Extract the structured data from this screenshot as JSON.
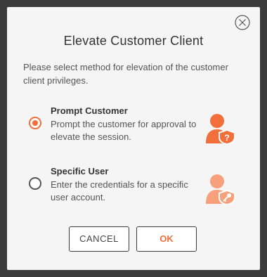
{
  "dialog": {
    "title": "Elevate Customer Client",
    "description": "Please select method for elevation of the customer client privileges.",
    "close_icon": "close-icon"
  },
  "options": [
    {
      "title": "Prompt Customer",
      "description": "Prompt the customer for approval to elevate the session.",
      "selected": true,
      "icon": "user-shield-question-icon"
    },
    {
      "title": "Specific User",
      "description": "Enter the credentials for a specific user account.",
      "selected": false,
      "icon": "user-shield-key-icon"
    }
  ],
  "buttons": {
    "cancel_label": "CANCEL",
    "ok_label": "OK"
  },
  "colors": {
    "accent": "#f26e3a",
    "accent_light": "#f7a07c",
    "background": "#f5f5f5",
    "backdrop": "#3b3b3b"
  }
}
